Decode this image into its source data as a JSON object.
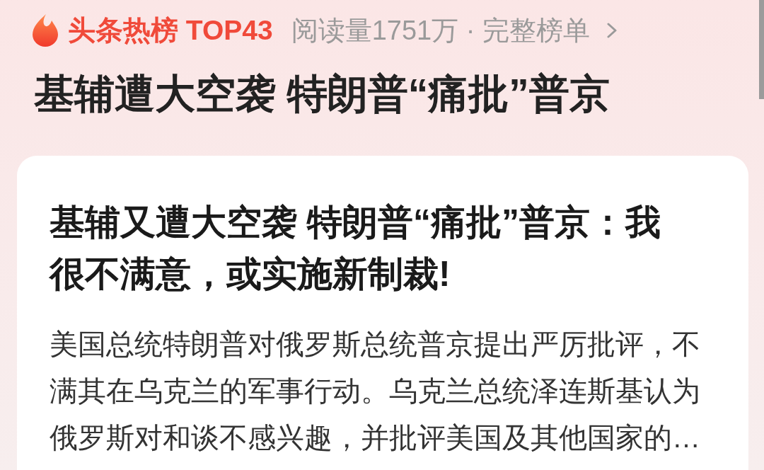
{
  "hot_list": {
    "title": "头条热榜 TOP43",
    "link": "阅读量1751万 · 完整榜单"
  },
  "headline": "基辅遭大空袭 特朗普“痛批”普京",
  "card": {
    "title": "基辅又遭大空袭 特朗普“痛批”普京：我很不满意，或实施新制裁!",
    "summary": "美国总统特朗普对俄罗斯总统普京提出严厉批评，不满其在乌克兰的军事行动。乌克兰总统泽连斯基认为俄罗斯对和谈不感兴趣，并批评美国及其他国家的…"
  }
}
